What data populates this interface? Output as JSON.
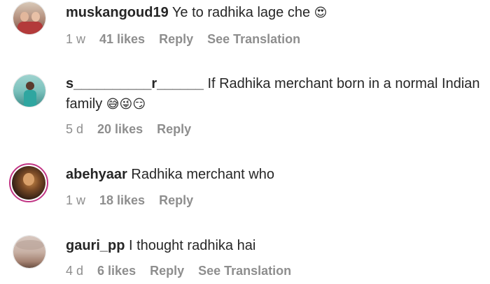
{
  "comments": [
    {
      "username": "muskangoud19",
      "text": "Ye to radhika lage che",
      "emoji": "😍",
      "age": "1 w",
      "likes": "41 likes",
      "reply": "Reply",
      "translation": "See Translation"
    },
    {
      "username": "s__________r______",
      "text": "If Radhika merchant born in a normal Indian family",
      "emoji": "😅😜😏",
      "age": "5 d",
      "likes": "20 likes",
      "reply": "Reply"
    },
    {
      "username": "abehyaar",
      "text": "Radhika merchant who",
      "age": "1 w",
      "likes": "18 likes",
      "reply": "Reply"
    },
    {
      "username": "gauri_pp",
      "text": "I thought radhika hai",
      "age": "4 d",
      "likes": "6 likes",
      "reply": "Reply",
      "translation": "See Translation"
    }
  ]
}
